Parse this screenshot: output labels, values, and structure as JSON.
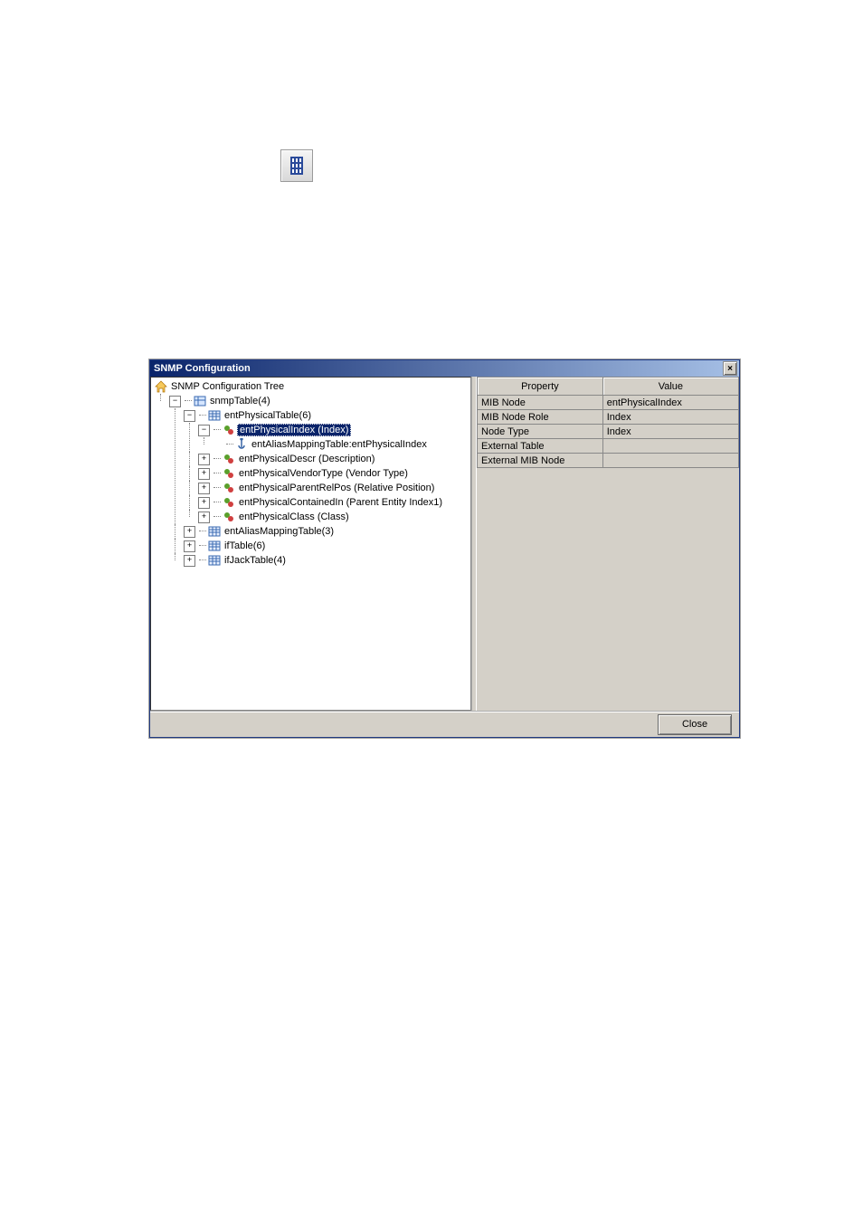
{
  "toolbar": {
    "icon_name": "grid-icon"
  },
  "dialog": {
    "title": "SNMP Configuration",
    "close_glyph": "×",
    "close_label": "Close"
  },
  "tree": {
    "root": "SNMP Configuration Tree",
    "snmpTable": "snmpTable(4)",
    "entPhysicalTable": "entPhysicalTable(6)",
    "entPhysicalIndex": "entPhysicalIndex (Index)",
    "entAliasMappingRef": "entAliasMappingTable:entPhysicalIndex",
    "entPhysicalDescr": "entPhysicalDescr (Description)",
    "entPhysicalVendorType": "entPhysicalVendorType (Vendor Type)",
    "entPhysicalParentRelPos": "entPhysicalParentRelPos (Relative Position)",
    "entPhysicalContainedIn": "entPhysicalContainedIn (Parent Entity Index1)",
    "entPhysicalClass": "entPhysicalClass (Class)",
    "entAliasMappingTable": "entAliasMappingTable(3)",
    "ifTable": "ifTable(6)",
    "ifJackTable": "ifJackTable(4)"
  },
  "properties": {
    "headers": {
      "property": "Property",
      "value": "Value"
    },
    "rows": [
      {
        "property": "MIB Node",
        "value": "entPhysicalIndex"
      },
      {
        "property": "MIB Node Role",
        "value": "Index"
      },
      {
        "property": "Node Type",
        "value": "Index"
      },
      {
        "property": "External Table",
        "value": ""
      },
      {
        "property": "External MIB Node",
        "value": ""
      }
    ]
  }
}
